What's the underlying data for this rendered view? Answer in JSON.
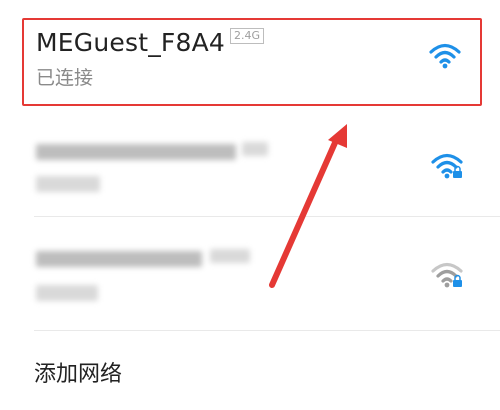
{
  "networks": {
    "connected": {
      "name": "MEGuest_F8A4",
      "band": "2.4G",
      "status": "已连接",
      "signal_icon": "wifi-full-icon",
      "accent_color": "#1e90e8",
      "highlight_color": "#e53935"
    },
    "others": [
      {
        "name_obscured": true,
        "secured": true,
        "signal_icon": "wifi-locked-icon",
        "icon_color": "#1e90e8"
      },
      {
        "name_obscured": true,
        "secured": true,
        "signal_icon": "wifi-locked-weak-icon",
        "icon_color": "#9e9e9e"
      }
    ]
  },
  "actions": {
    "add_network_label": "添加网络"
  },
  "annotation": {
    "arrow_color": "#e53935"
  }
}
